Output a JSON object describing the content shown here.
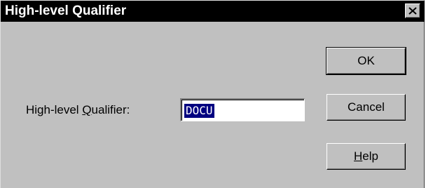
{
  "dialog": {
    "title": "High-level Qualifier",
    "close_icon": "close-icon"
  },
  "form": {
    "label_prefix": "High-level ",
    "label_mnemonic": "Q",
    "label_suffix": "ualifier:",
    "value": "DOCU"
  },
  "buttons": {
    "ok": "OK",
    "cancel": "Cancel",
    "help_mnemonic": "H",
    "help_rest": "elp"
  }
}
